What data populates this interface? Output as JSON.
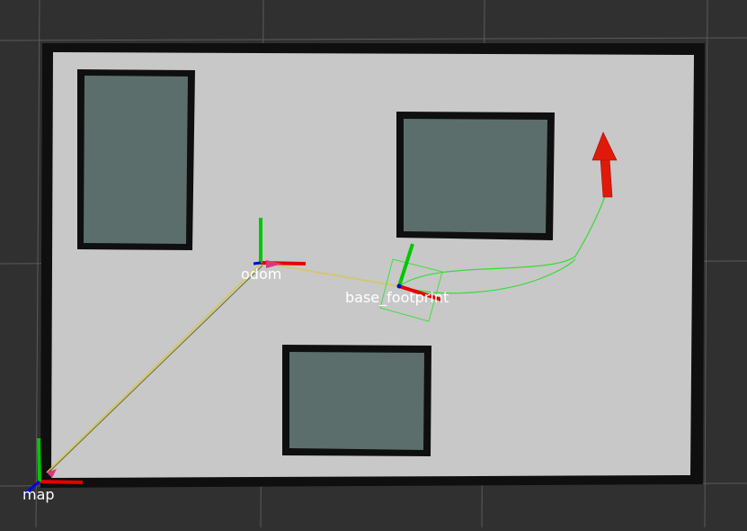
{
  "view": {
    "background_color": "#303030",
    "grid_color": "#5a5a5a",
    "map_free_color": "#c8c8c8",
    "map_wall_color": "#0f0f0f",
    "obstacle_color": "#5b6e6c"
  },
  "frames": {
    "map": {
      "label": "map"
    },
    "odom": {
      "label": "odom"
    },
    "base_footprint": {
      "label": "base_footprint"
    }
  },
  "axis_colors": {
    "x": "#e60000",
    "y": "#00c800",
    "z": "#0000e6"
  },
  "tf_link_color": "#d4c84a",
  "path": {
    "color": "#33dd33"
  },
  "footprint": {
    "color": "#40e040"
  },
  "goal": {
    "icon": "goal-arrow-icon",
    "color": "#e01a0a"
  }
}
